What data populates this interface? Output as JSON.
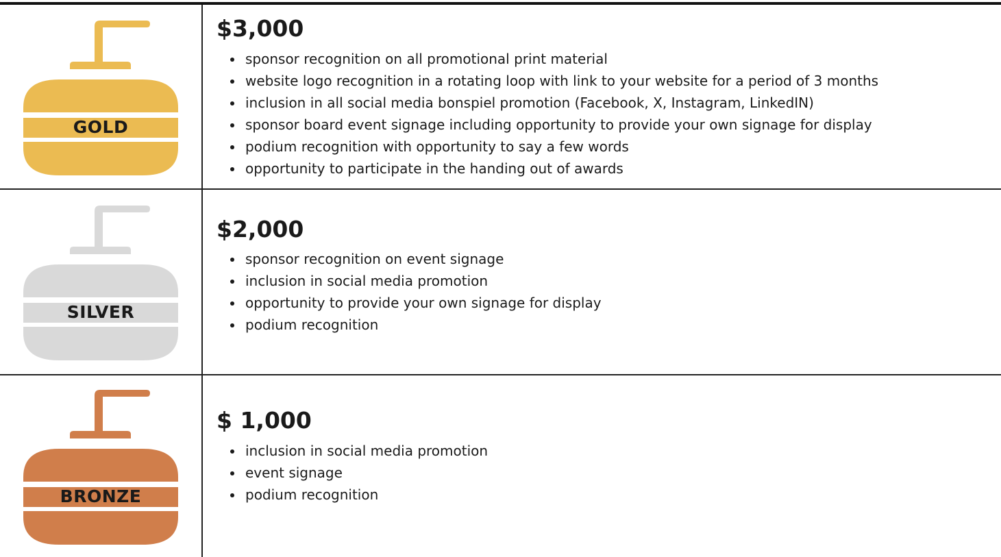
{
  "colors": {
    "gold": "#ebbb52",
    "silver": "#d9d9d9",
    "bronze": "#d07e4b",
    "stripe": "#ffffff",
    "rule": "#222222"
  },
  "tiers": [
    {
      "label": "GOLD",
      "price": "$3,000",
      "icon": "curling-stone-icon",
      "benefits": [
        "sponsor recognition on all promotional print material",
        "website logo recognition in a rotating loop with link to your website for a period of 3 months",
        "inclusion in all social media bonspiel promotion (Facebook, X, Instagram, LinkedIN)",
        "sponsor board event signage including opportunity to provide your own signage for display",
        "podium recognition with opportunity to say a few words",
        "opportunity to participate in the handing out of awards"
      ]
    },
    {
      "label": "SILVER",
      "price": "$2,000",
      "icon": "curling-stone-icon",
      "benefits": [
        "sponsor recognition on event signage",
        "inclusion in social media promotion",
        "opportunity to provide your own signage for display",
        "podium recognition"
      ]
    },
    {
      "label": "BRONZE",
      "price": "$ 1,000",
      "icon": "curling-stone-icon",
      "benefits": [
        "inclusion in social media promotion",
        "event signage",
        "podium recognition"
      ]
    }
  ]
}
